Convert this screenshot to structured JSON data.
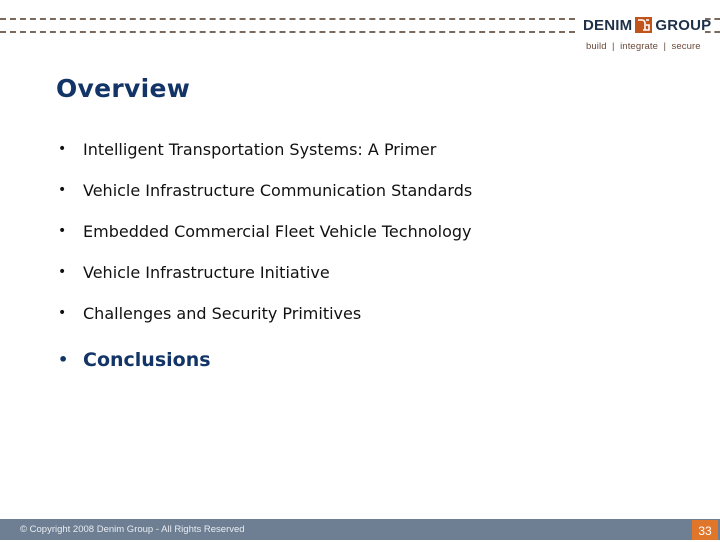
{
  "header": {
    "logo": {
      "word1": "DENIM",
      "word2": "GROUP",
      "mark": "dg-logo-mark"
    },
    "tagline": "build  |  integrate  |  secure"
  },
  "slide": {
    "title": "Overview",
    "bullets": [
      {
        "text": "Intelligent Transportation Systems: A Primer",
        "emphasis": false
      },
      {
        "text": "Vehicle Infrastructure Communication Standards",
        "emphasis": false
      },
      {
        "text": "Embedded Commercial Fleet Vehicle Technology",
        "emphasis": false
      },
      {
        "text": "Vehicle Infrastructure Initiative",
        "emphasis": false
      },
      {
        "text": "Challenges and Security Primitives",
        "emphasis": false
      },
      {
        "text": "Conclusions",
        "emphasis": true
      }
    ],
    "bullet_glyph": "•"
  },
  "footer": {
    "copyright": "© Copyright 2008 Denim Group - All Rights Reserved",
    "page_number": "33"
  },
  "colors": {
    "title": "#123466",
    "footer_bar": "#6e7f94",
    "page_badge": "#e0762a",
    "dash_lines": "#7a6a5e"
  }
}
